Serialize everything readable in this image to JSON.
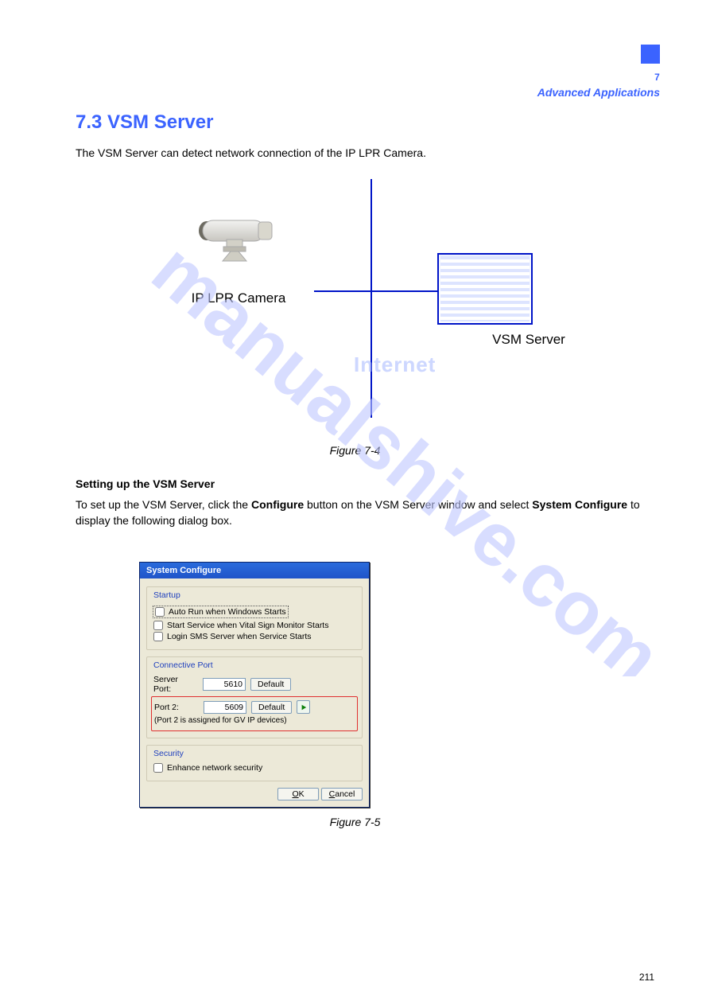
{
  "chapter_label": "Advanced Applications",
  "chapter_num": "7",
  "section_title": "7.3  VSM Server",
  "intro": "The VSM Server can detect network connection of the IP LPR Camera.",
  "diagram": {
    "left_label": "IP LPR Camera",
    "right_label": "VSM Server",
    "internet": "Internet"
  },
  "figure1_caption": "Figure 7-4",
  "setup_heading": "Setting up the VSM Server",
  "setup_body_prefix": "To set up the VSM Server, click the ",
  "setup_body_bold1": "Configure",
  "setup_body_mid": " button on the VSM Server window and select ",
  "setup_body_bold2": "System Configure",
  "setup_body_suffix": " to display the following dialog box.",
  "dialog": {
    "title": "System Configure",
    "startup": {
      "legend": "Startup",
      "auto_run": "Auto Run when Windows Starts",
      "start_service": "Start Service when Vital Sign Monitor Starts",
      "login_sms": "Login SMS Server when Service Starts"
    },
    "conn": {
      "legend": "Connective Port",
      "server_port_label": "Server Port:",
      "server_port_value": "5610",
      "port2_label": "Port 2:",
      "port2_value": "5609",
      "default_btn": "Default",
      "hint": "(Port 2 is assigned for GV IP devices)"
    },
    "security": {
      "legend": "Security",
      "enhance": "Enhance network security"
    },
    "ok": "OK",
    "cancel": "Cancel"
  },
  "figure2_caption": "Figure 7-5",
  "page_number": "211"
}
